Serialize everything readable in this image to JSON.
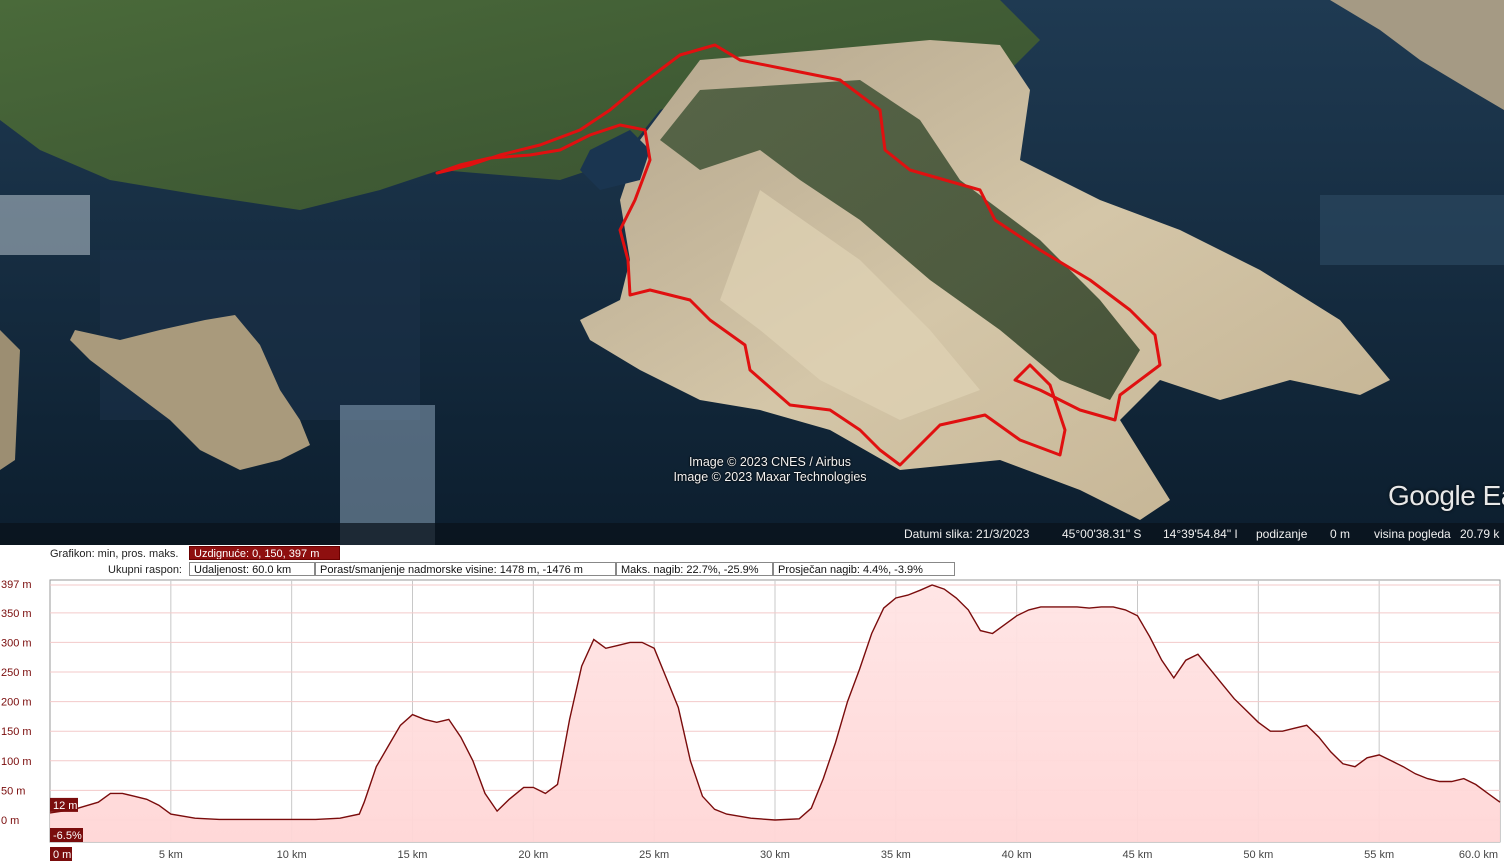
{
  "map": {
    "attribution_lines": [
      "Image © 2023 CNES / Airbus",
      "Image © 2023 Maxar Technologies"
    ],
    "logo_text": "Google Ea",
    "track_color": "#e01010"
  },
  "statusbar": {
    "image_date": "Datumi slika: 21/3/2023",
    "latitude": "45°00'38.31\" S",
    "longitude": "14°39'54.84\" I",
    "elevation_label": "podizanje",
    "elevation_value": "0 m",
    "eye_alt_label": "visina pogleda",
    "eye_alt_value": "20.79 k"
  },
  "profile_panel": {
    "graph_label": "Grafikon: min, pros. maks.",
    "graph_value": "Uzdignuće: 0, 150, 397 m",
    "range_label": "Ukupni raspon:",
    "distance": "Udaljenost: 60.0 km",
    "gain_loss": "Porast/smanjenje nadmorske visine: 1478 m, -1476 m",
    "max_slope": "Maks. nagib: 22.7%, -25.9%",
    "avg_slope": "Prosječan nagib: 4.4%, -3.9%",
    "cursor_elevation": "12 m",
    "cursor_slope": "-6.5%",
    "cursor_distance": "0 m"
  },
  "chart_data": {
    "type": "area",
    "xlabel": "",
    "ylabel": "",
    "xlim": [
      0,
      60
    ],
    "ylim": [
      -20,
      397
    ],
    "x_tick_labels": [
      "5 km",
      "10 km",
      "15 km",
      "20 km",
      "25 km",
      "30 km",
      "35 km",
      "40 km",
      "45 km",
      "50 km",
      "55 km",
      "60.0 km"
    ],
    "x_tick_values": [
      5,
      10,
      15,
      20,
      25,
      30,
      35,
      40,
      45,
      50,
      55,
      60
    ],
    "y_tick_labels": [
      "397 m",
      "350 m",
      "300 m",
      "250 m",
      "200 m",
      "150 m",
      "100 m",
      "50 m",
      "0 m"
    ],
    "y_tick_values": [
      397,
      350,
      300,
      250,
      200,
      150,
      100,
      50,
      0
    ],
    "line_color": "#7a0c0c",
    "fill_color": "#ffd6d6",
    "x": [
      0,
      1,
      2,
      2.5,
      3,
      3.5,
      4,
      4.5,
      5,
      6,
      7,
      8,
      9,
      10,
      11,
      12,
      12.8,
      13,
      13.5,
      14,
      14.5,
      15,
      15.5,
      16,
      16.5,
      17,
      17.5,
      18,
      18.5,
      19,
      19.3,
      19.6,
      20,
      20.5,
      21,
      21.5,
      22,
      22.5,
      23,
      23.5,
      24,
      24.5,
      25,
      25.5,
      26,
      26.5,
      27,
      27.5,
      28,
      29,
      30,
      31,
      31.5,
      32,
      32.5,
      33,
      33.5,
      34,
      34.5,
      35,
      35.5,
      36,
      36.5,
      37,
      37.5,
      38,
      38.5,
      39,
      39.5,
      40,
      40.5,
      41,
      41.5,
      42,
      42.5,
      43,
      43.5,
      44,
      44.5,
      45,
      45.5,
      46,
      46.5,
      47,
      47.5,
      48,
      48.5,
      49,
      49.5,
      50,
      50.5,
      51,
      51.5,
      52,
      52.5,
      53,
      53.5,
      54,
      54.5,
      55,
      55.5,
      56,
      56.5,
      57,
      57.5,
      58,
      58.5,
      59,
      59.5,
      60
    ],
    "y": [
      12,
      18,
      30,
      45,
      45,
      40,
      35,
      25,
      10,
      3,
      1,
      1,
      1,
      1,
      1,
      3,
      10,
      30,
      90,
      125,
      160,
      178,
      170,
      165,
      170,
      140,
      100,
      45,
      15,
      35,
      45,
      55,
      55,
      45,
      60,
      170,
      260,
      305,
      290,
      295,
      300,
      300,
      290,
      240,
      190,
      100,
      40,
      18,
      10,
      3,
      0,
      2,
      20,
      70,
      130,
      200,
      255,
      315,
      358,
      375,
      380,
      388,
      397,
      390,
      375,
      355,
      320,
      315,
      330,
      345,
      355,
      360,
      360,
      360,
      360,
      358,
      360,
      360,
      355,
      345,
      310,
      270,
      240,
      270,
      280,
      255,
      230,
      205,
      185,
      165,
      150,
      150,
      155,
      160,
      140,
      115,
      95,
      90,
      105,
      110,
      100,
      90,
      78,
      70,
      65,
      65,
      70,
      60,
      45,
      30,
      15,
      20
    ]
  }
}
